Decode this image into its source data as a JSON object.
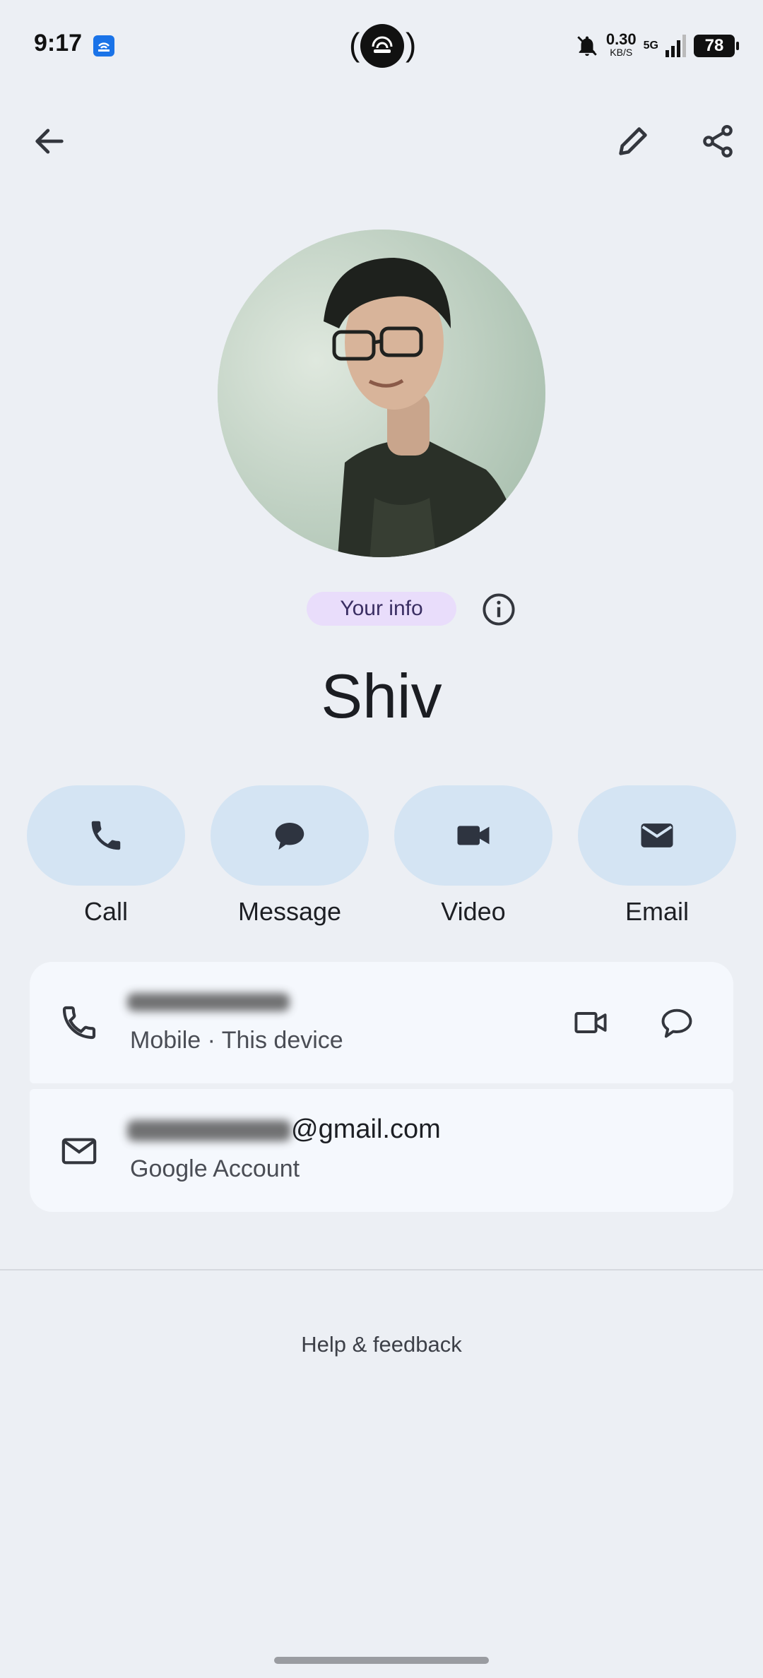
{
  "status_bar": {
    "time": "9:17",
    "speed_value": "0.30",
    "speed_unit": "KB/S",
    "network": "5G",
    "battery": "78"
  },
  "toolbar": {
    "back_icon": "arrow-left-icon",
    "edit_icon": "pencil-icon",
    "share_icon": "share-icon"
  },
  "profile": {
    "badge": "Your info",
    "name": "Shiv"
  },
  "actions": [
    {
      "label": "Call",
      "icon": "phone-icon"
    },
    {
      "label": "Message",
      "icon": "message-icon"
    },
    {
      "label": "Video",
      "icon": "video-icon"
    },
    {
      "label": "Email",
      "icon": "email-icon"
    }
  ],
  "details": {
    "phone_type": "Mobile · This device",
    "email_domain": "@gmail.com",
    "email_type": "Google Account"
  },
  "footer": {
    "help": "Help & feedback"
  },
  "colors": {
    "background": "#eceff4",
    "action_bg": "#d4e4f3",
    "badge_bg": "#e9ddfb",
    "card_bg": "#f5f8fd"
  }
}
